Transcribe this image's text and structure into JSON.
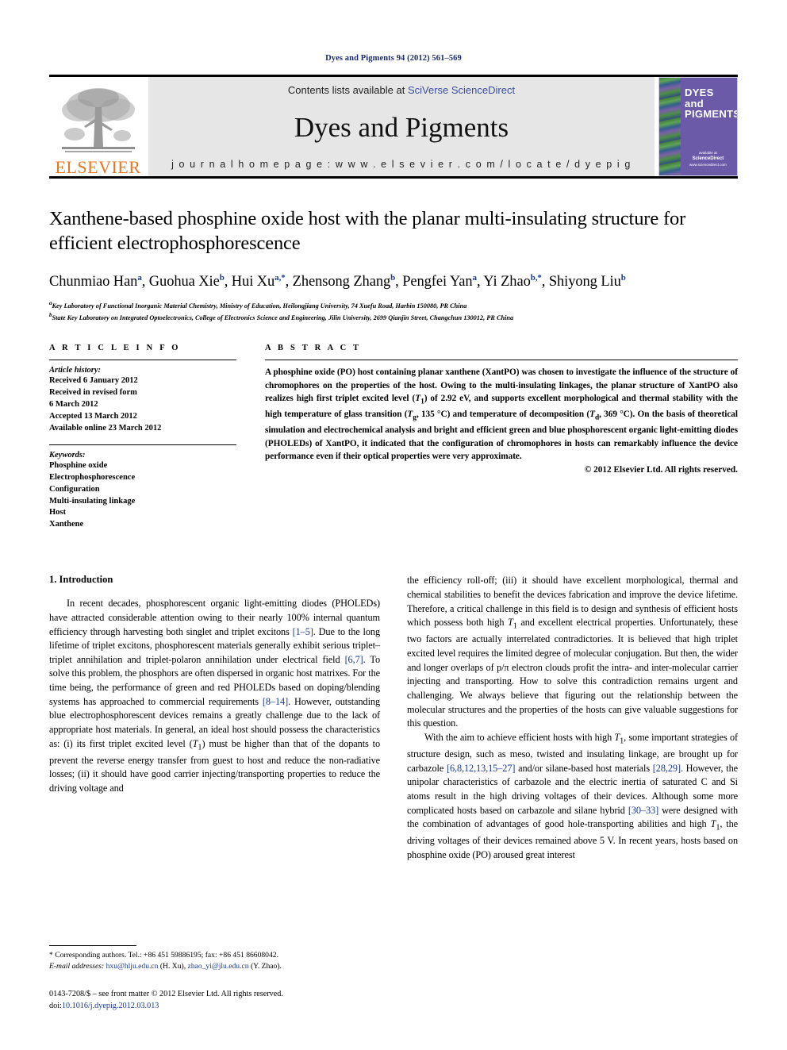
{
  "running_head": "Dyes and Pigments 94 (2012) 561–569",
  "masthead": {
    "publisher_logo_text": "ELSEVIER",
    "contents_prefix": "Contents lists available at ",
    "contents_link": "SciVerse ScienceDirect",
    "journal_title": "Dyes and Pigments",
    "homepage_label": "j o u r n a l   h o m e p a g e :   w w w . e l s e v i e r . c o m / l o c a t e / d y e p i g",
    "cover": {
      "line1": "DYES",
      "line2": "and",
      "line3": "PIGMENTS",
      "footer_small": "available at",
      "footer_brand": "ScienceDirect",
      "footer_url": "www.sciencedirect.com"
    }
  },
  "article": {
    "title": "Xanthene-based phosphine oxide host with the planar multi-insulating structure for efficient electrophosphorescence",
    "authors_html": "Chunmiao Han<sup>a</sup>, Guohua Xie<sup>b</sup>, Hui Xu<sup>a,*</sup>, Zhensong Zhang<sup>b</sup>, Pengfei Yan<sup>a</sup>, Yi Zhao<sup>b,*</sup>, Shiyong Liu<sup>b</sup>",
    "affiliations": [
      {
        "marker": "a",
        "text": "Key Laboratory of Functional Inorganic Material Chemistry, Ministry of Education, Heilongjiang University, 74 Xuefu Road, Harbin 150080, PR China"
      },
      {
        "marker": "b",
        "text": "State Key Laboratory on Integrated Optoelectronics, College of Electronics Science and Engineering, Jilin University, 2699 Qianjin Street, Changchun 130012, PR China"
      }
    ]
  },
  "article_info": {
    "label": "A R T I C L E   I N F O",
    "history_heading": "Article history:",
    "history": [
      "Received 6 January 2012",
      "Received in revised form",
      "6 March 2012",
      "Accepted 13 March 2012",
      "Available online 23 March 2012"
    ],
    "keywords_heading": "Keywords:",
    "keywords": [
      "Phosphine oxide",
      "Electrophosphorescence",
      "Configuration",
      "Multi-insulating linkage",
      "Host",
      "Xanthene"
    ]
  },
  "abstract": {
    "label": "A B S T R A C T",
    "text_html": "A phosphine oxide (PO) host containing planar xanthene (<b>XantPO</b>) was chosen to investigate the influence of the structure of chromophores on the properties of the host. Owing to the multi-insulating linkages, the planar structure of <b>XantPO</b> also realizes high first triplet excited level (<i>T</i><sub>1</sub>) of 2.92 eV, and supports excellent morphological and thermal stability with the high temperature of glass transition (<i>T</i><sub>g</sub>, 135 &deg;C) and temperature of decomposition (<i>T</i><sub>d</sub>, 369 &deg;C). On the basis of theoretical simulation and electrochemical analysis and bright and efficient green and blue phosphorescent organic light-emitting diodes (PHOLEDs) of <b>XantPO</b>, it indicated that the configuration of chromophores in hosts can remarkably influence the device performance even if their optical properties were very approximate.",
    "copyright": "© 2012 Elsevier Ltd. All rights reserved."
  },
  "body": {
    "section_number_title": "1.  Introduction",
    "left_paragraphs_html": [
      "In recent decades, phosphorescent organic light-emitting diodes (PHOLEDs) have attracted considerable attention owing to their nearly 100% internal quantum efficiency through harvesting both singlet and triplet excitons <span class=\"ref\">[1&ndash;5]</span>. Due to the long lifetime of triplet excitons, phosphorescent materials generally exhibit serious triplet&ndash;triplet annihilation and triplet-polaron annihilation under electrical field <span class=\"ref\">[6,7]</span>. To solve this problem, the phosphors are often dispersed in organic host matrixes. For the time being, the performance of green and red PHOLEDs based on doping/blending systems has approached to commercial requirements <span class=\"ref\">[8&ndash;14]</span>. However, outstanding blue electrophosphorescent devices remains a greatly challenge due to the lack of appropriate host materials. In general, an ideal host should possess the characteristics as: (i) its first triplet excited level (<i>T</i><sub>1</sub>) must be higher than that of the dopants to prevent the reverse energy transfer from guest to host and reduce the non-radiative losses; (ii) it should have good carrier injecting/transporting properties to reduce the driving voltage and"
    ],
    "right_paragraphs_html": [
      "the efficiency roll-off; (iii) it should have excellent morphological, thermal and chemical stabilities to benefit the devices fabrication and improve the device lifetime. Therefore, a critical challenge in this field is to design and synthesis of efficient hosts which possess both high <i>T</i><sub>1</sub> and excellent electrical properties. Unfortunately, these two factors are actually interrelated contradictories. It is believed that high triplet excited level requires the limited degree of molecular conjugation. But then, the wider and longer overlaps of p/&pi; electron clouds profit the intra- and inter-molecular carrier injecting and transporting. How to solve this contradiction remains urgent and challenging. We always believe that figuring out the relationship between the molecular structures and the properties of the hosts can give valuable suggestions for this question.",
      "With the aim to achieve efficient hosts with high <i>T</i><sub>1</sub>, some important strategies of structure design, such as meso, twisted and insulating linkage, are brought up for carbazole <span class=\"ref\">[6,8,12,13,15&ndash;27]</span> and/or silane-based host materials <span class=\"ref\">[28,29]</span>. However, the unipolar characteristics of carbazole and the electric inertia of saturated C and Si atoms result in the high driving voltages of their devices. Although some more complicated hosts based on carbazole and silane hybrid <span class=\"ref\">[30&ndash;33]</span> were designed with the combination of advantages of good hole-transporting abilities and high <i>T</i><sub>1</sub>, the driving voltages of their devices remained above 5 V. In recent years, hosts based on phosphine oxide (PO) aroused great interest"
    ]
  },
  "footnotes": {
    "corresponding_html": "*  Corresponding authors. Tel.: +86 451 59886195; fax: +86 451 86608042.",
    "emails_html": "<span class=\"em\">E-mail addresses:</span> <span class=\"fn-link\">hxu@hlju.edu.cn</span> (H. Xu), <span class=\"fn-link\">zhao_yi@jlu.edu.cn</span> (Y. Zhao).",
    "issn_html": "0143-7208/$ &ndash; see front matter &copy; 2012 Elsevier Ltd. All rights reserved.",
    "doi_prefix": "doi:",
    "doi_value": "10.1016/j.dyepig.2012.03.013"
  }
}
